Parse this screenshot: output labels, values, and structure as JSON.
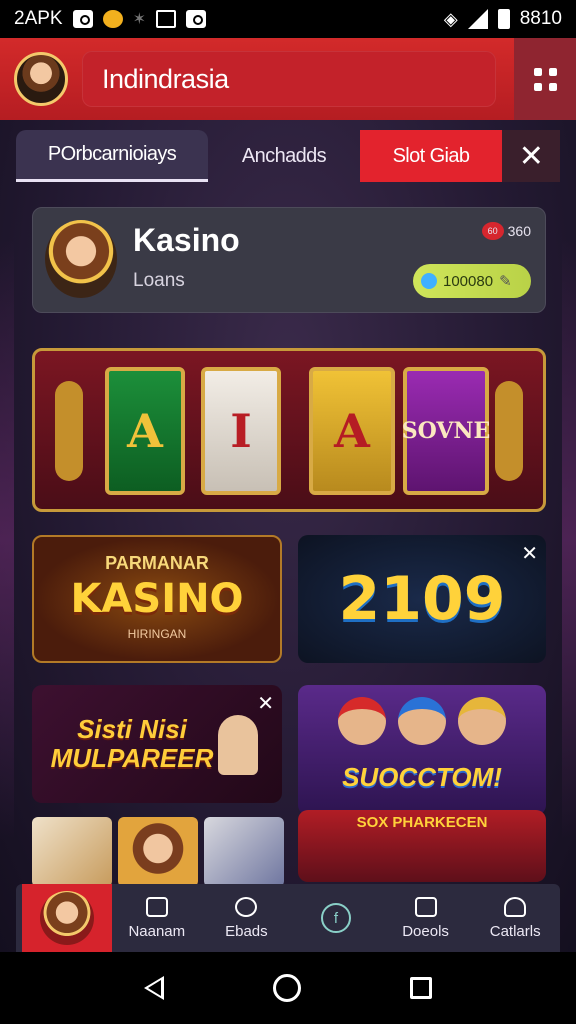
{
  "status_bar": {
    "carrier": "2APK",
    "time": "8810",
    "icons": [
      "camera-icon",
      "coin-icon",
      "bluetooth-icon",
      "image-icon",
      "photo-icon",
      "wifi-icon",
      "signal-icon",
      "battery-icon"
    ]
  },
  "header": {
    "title": "Indindrasia",
    "menu_icon": "grid-dots-icon"
  },
  "tabs": [
    {
      "label": "POrbcarnioiays",
      "active": true
    },
    {
      "label": "Anchadds",
      "active": false
    },
    {
      "label": "Slot Giab",
      "active": false,
      "highlight": "#e3232d"
    }
  ],
  "profile": {
    "name": "Kasino",
    "subtitle": "Loans",
    "badge_text": "360",
    "badge_icon_text": "60",
    "balance": "100080"
  },
  "slot_banner": {
    "reels": [
      "A",
      "I",
      "A",
      "SOVNE"
    ]
  },
  "tiles": {
    "kasino": {
      "top": "PARMANAR",
      "main": "KASINO",
      "bottom": "HIRINGAN"
    },
    "number": {
      "value": "2109"
    },
    "multiplayer": {
      "line1": "Sisti Nisi",
      "line2": "MULPAREER"
    },
    "success": {
      "text": "SUOCCTOM!"
    },
    "feature": {
      "text": "SOX PHARKECEN"
    }
  },
  "bottom_nav": {
    "items": [
      {
        "label": "Naanam",
        "icon": "home-icon"
      },
      {
        "label": "Ebads",
        "icon": "gift-icon"
      },
      {
        "label": "",
        "icon": "info-circle-icon"
      },
      {
        "label": "Doeols",
        "icon": "wallet-icon"
      },
      {
        "label": "Catlarls",
        "icon": "user-icon"
      }
    ]
  },
  "colors": {
    "accent_red": "#d6232c",
    "header_red": "#c3222a",
    "bg_dark": "#241a33",
    "gold": "#ffd23a"
  }
}
